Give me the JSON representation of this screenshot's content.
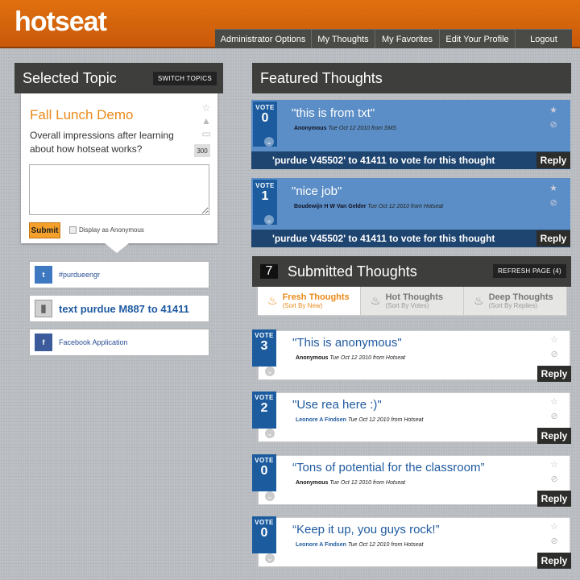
{
  "app": {
    "logo": "hotseat"
  },
  "nav": {
    "items": [
      "Administrator Options",
      "My Thoughts",
      "My Favorites",
      "Edit Your Profile",
      "Logout"
    ]
  },
  "selected": {
    "heading": "Selected Topic",
    "switch_label": "SWITCH TOPICS",
    "topic_title": "Fall Lunch Demo",
    "topic_desc": "Overall impressions after learning about how hotseat works?",
    "char_count": "300",
    "submit_label": "Submit",
    "anon_label": "Display as Anonymous"
  },
  "social": {
    "twitter": "#purdueengr",
    "sms": "text purdue M887 to 41411",
    "facebook": "Facebook Application"
  },
  "featured": {
    "heading": "Featured Thoughts",
    "vote_label": "VOTE",
    "reply_label": "Reply",
    "items": [
      {
        "votes": "0",
        "text": "\"this is from txt\"",
        "author": "Anonymous",
        "date": "Tue Oct 12 2010 from SMS",
        "sms": "'purdue V45502' to 41411 to vote for this thought"
      },
      {
        "votes": "1",
        "text": "\"nice job\"",
        "author": "Boudewijn H W Van Gelder",
        "date": "Tue Oct 12 2010 from Hotseat",
        "sms": "'purdue V45502' to 41411 to vote for this thought"
      }
    ]
  },
  "submitted": {
    "count": "7",
    "heading": "Submitted Thoughts",
    "refresh_label": "REFRESH PAGE (4)",
    "tabs": [
      {
        "title": "Fresh Thoughts",
        "sub": "(Sort By New)"
      },
      {
        "title": "Hot Thoughts",
        "sub": "(Sort By Votes)"
      },
      {
        "title": "Deep Thoughts",
        "sub": "(Sort By Replies)"
      }
    ],
    "vote_label": "VOTE",
    "reply_label": "Reply",
    "items": [
      {
        "votes": "3",
        "text": "\"This is anonymous\"",
        "author": "Anonymous",
        "date": "Tue Oct 12 2010 from Hotseat"
      },
      {
        "votes": "2",
        "text": "\"Use rea here :)\"",
        "author": "Leonore A Findsen",
        "date": "Tue Oct 12 2010 from Hotseat"
      },
      {
        "votes": "0",
        "text": "“Tons of potential for the classroom”",
        "author": "Anonymous",
        "date": "Tue Oct 12 2010 from Hotseat"
      },
      {
        "votes": "0",
        "text": "“Keep it up, you guys rock!”",
        "author": "Leonore A Findsen",
        "date": "Tue Oct 12 2010 from Hotseat"
      }
    ]
  },
  "colors": {
    "header": "#d9650c",
    "accent": "#e98a1a",
    "vote": "#1b5b9e",
    "featured": "#5b8ec6",
    "dark": "#3e3f3c"
  }
}
